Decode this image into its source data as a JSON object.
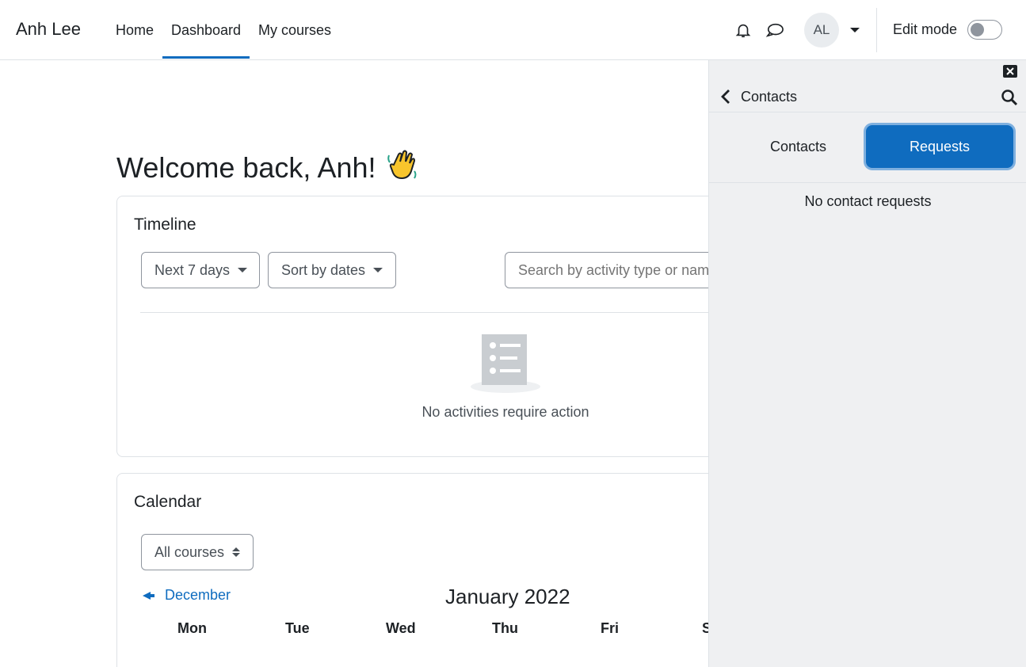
{
  "navbar": {
    "brand": "Anh Lee",
    "links": [
      "Home",
      "Dashboard",
      "My courses"
    ],
    "avatar_initials": "AL",
    "edit_mode_label": "Edit mode",
    "edit_mode_on": false
  },
  "main": {
    "welcome": "Welcome back, Anh!",
    "welcome_emoji": "👋",
    "timeline": {
      "title": "Timeline",
      "filter_label": "Next 7 days",
      "sort_label": "Sort by dates",
      "search_placeholder": "Search by activity type or name",
      "empty_text": "No activities require action"
    },
    "calendar": {
      "title": "Calendar",
      "course_filter": "All courses",
      "prev_month": "December",
      "month_title": "January 2022",
      "days": [
        "Mon",
        "Tue",
        "Wed",
        "Thu",
        "Fri",
        "Sat"
      ]
    }
  },
  "drawer": {
    "title": "Contacts",
    "tabs": [
      "Contacts",
      "Requests"
    ],
    "active_tab": "Requests",
    "empty_text": "No contact requests"
  },
  "colors": {
    "accent": "#0f6cbf",
    "drawer_bg": "#eff0f2",
    "border": "#dee2e6"
  }
}
